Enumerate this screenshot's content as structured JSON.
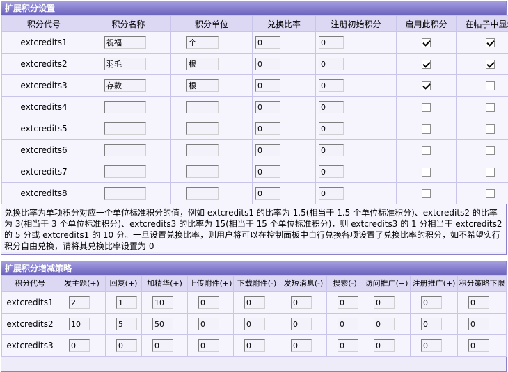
{
  "section1": {
    "title": "扩展积分设置",
    "columns": [
      "积分代号",
      "积分名称",
      "积分单位",
      "兑换比率",
      "注册初始积分",
      "启用此积分",
      "在帖子中显示"
    ],
    "rows": [
      {
        "code": "extcredits1",
        "name": "祝福",
        "unit": "个",
        "ratio": "0",
        "init": "0",
        "enabled": true,
        "show": true
      },
      {
        "code": "extcredits2",
        "name": "羽毛",
        "unit": "根",
        "ratio": "0",
        "init": "0",
        "enabled": true,
        "show": true
      },
      {
        "code": "extcredits3",
        "name": "存款",
        "unit": "根",
        "ratio": "0",
        "init": "0",
        "enabled": true,
        "show": false
      },
      {
        "code": "extcredits4",
        "name": "",
        "unit": "",
        "ratio": "0",
        "init": "0",
        "enabled": false,
        "show": false
      },
      {
        "code": "extcredits5",
        "name": "",
        "unit": "",
        "ratio": "0",
        "init": "0",
        "enabled": false,
        "show": false
      },
      {
        "code": "extcredits6",
        "name": "",
        "unit": "",
        "ratio": "0",
        "init": "0",
        "enabled": false,
        "show": false
      },
      {
        "code": "extcredits7",
        "name": "",
        "unit": "",
        "ratio": "0",
        "init": "0",
        "enabled": false,
        "show": false
      },
      {
        "code": "extcredits8",
        "name": "",
        "unit": "",
        "ratio": "0",
        "init": "0",
        "enabled": false,
        "show": false
      }
    ],
    "note": "兑换比率为单项积分对应一个单位标准积分的值，例如 extcredits1 的比率为 1.5(相当于 1.5 个单位标准积分)、extcredits2 的比率为 3(相当于 3 个单位标准积分)、extcredits3 的比率为 15(相当于 15 个单位标准积分)，则 extcredits3 的 1 分相当于 extcredits2 的 5 分或 extcredits1 的 10 分。一旦设置兑换比率，则用户将可以在控制面板中自行兑换各项设置了兑换比率的积分，如不希望实行积分自由兑换，请将其兑换比率设置为 0"
  },
  "section2": {
    "title": "扩展积分增减策略",
    "columns": [
      "积分代号",
      "发主题(+)",
      "回复(+)",
      "加精华(+)",
      "上传附件(+)",
      "下载附件(-)",
      "发短消息(-)",
      "搜索(-)",
      "访问推广(+)",
      "注册推广(+)",
      "积分策略下限"
    ],
    "rows": [
      {
        "code": "extcredits1",
        "values": [
          "2",
          "1",
          "10",
          "0",
          "0",
          "0",
          "0",
          "0",
          "0",
          "0"
        ]
      },
      {
        "code": "extcredits2",
        "values": [
          "10",
          "5",
          "50",
          "0",
          "0",
          "0",
          "0",
          "0",
          "0",
          "0"
        ]
      },
      {
        "code": "extcredits3",
        "values": [
          "0",
          "0",
          "0",
          "0",
          "0",
          "0",
          "0",
          "0",
          "0",
          "0"
        ]
      }
    ]
  }
}
